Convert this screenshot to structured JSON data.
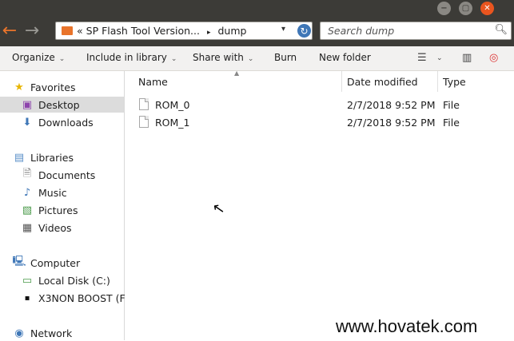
{
  "window": {
    "controls": {
      "minimize": "−",
      "maximize": "▢",
      "close": "✕"
    }
  },
  "address": {
    "prefix": "«",
    "segments": [
      "SP Flash Tool Version...",
      "dump"
    ],
    "separator": "▸",
    "dropdown": "▾",
    "refresh_icon": "refresh-icon"
  },
  "search": {
    "placeholder": "Search dump",
    "icon": "search-icon"
  },
  "toolbar": {
    "organize": "Organize",
    "include_in_library": "Include in library",
    "share_with": "Share with",
    "burn": "Burn",
    "new_folder": "New folder",
    "chevron": "⌄"
  },
  "sidebar": {
    "favorites": {
      "label": "Favorites",
      "items": [
        "Desktop",
        "Downloads"
      ]
    },
    "libraries": {
      "label": "Libraries",
      "items": [
        "Documents",
        "Music",
        "Pictures",
        "Videos"
      ]
    },
    "computer": {
      "label": "Computer",
      "items": [
        "Local Disk (C:)",
        "X3NON BOOST (F"
      ]
    },
    "network": {
      "label": "Network"
    },
    "selected": "Desktop"
  },
  "columns": [
    "Name",
    "Date modified",
    "Type"
  ],
  "files": [
    {
      "name": "ROM_0",
      "date": "2/7/2018 9:52 PM",
      "type": "File"
    },
    {
      "name": "ROM_1",
      "date": "2/7/2018 9:52 PM",
      "type": "File"
    }
  ],
  "watermark": "www.hovatek.com",
  "colors": {
    "titlebar": "#3c3b37",
    "accent_orange": "#e9551f",
    "toolbar_bg": "#f2f1f0",
    "selection": "#dcdcdc"
  }
}
